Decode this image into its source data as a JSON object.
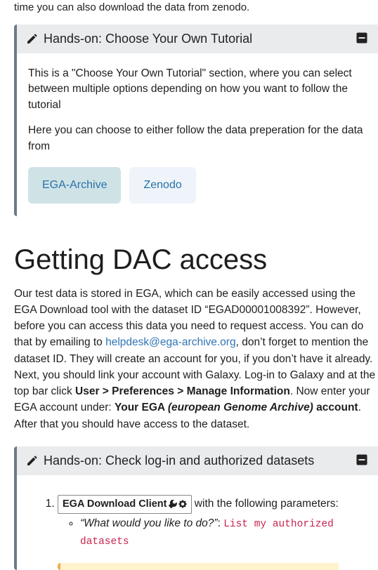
{
  "intro_tail": "time you can also download the data from zenodo.",
  "handsOn1": {
    "title": "Hands-on: Choose Your Own Tutorial",
    "body1": "This is a \"Choose Your Own Tutorial\" section, where you can select between multiple options depending on how you want to follow the tutorial",
    "body2": "Here you can choose to either follow the data preperation for the data from",
    "tab_active": "EGA-Archive",
    "tab_inactive": "Zenodo"
  },
  "sectionHeading": "Getting DAC access",
  "para": {
    "p1a": "Our test data is stored in EGA, which can be easily accessed using the EGA Download tool with the dataset ID “EGAD00001008392”. However, before you can access this data you need to request access. You can do that by emailing to ",
    "email": "helpdesk@ega-archive.org",
    "p1b": ", don’t forget to mention the dataset ID. They will create an account for you, if you don’t have it already. Next, you should link your account with Galaxy. Log-in to Galaxy and at the top bar click ",
    "menu_path": "User > Preferences > Manage Information",
    "p1c": ". Now enter your EGA account under: ",
    "your_ega_a": "Your EGA ",
    "your_ega_i": "(european Genome Archive)",
    "your_ega_b": " account",
    "p1d": ". After that you should have access to the dataset."
  },
  "handsOn2": {
    "title": "Hands-on: Check log-in and authorized datasets",
    "tool_name": "EGA Download Client",
    "step1_tail": " with the following parameters:",
    "param_label": "“What would you like to do?”",
    "param_sep": ": ",
    "param_value": "List my authorized datasets"
  }
}
